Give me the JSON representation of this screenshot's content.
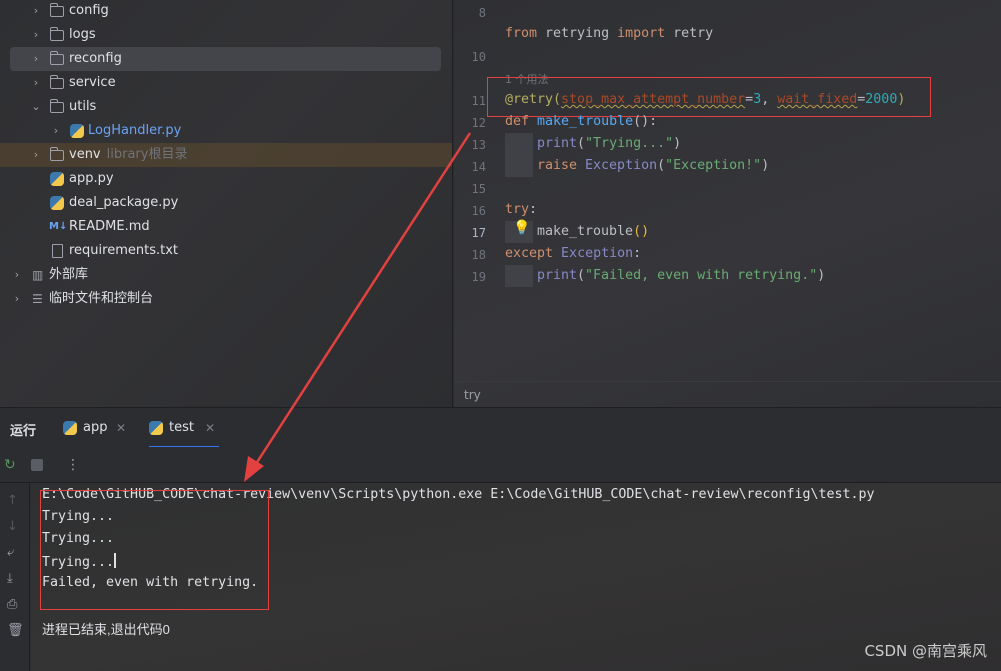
{
  "project_tree": {
    "items": [
      {
        "label": "config",
        "hint": ""
      },
      {
        "label": "logs",
        "hint": ""
      },
      {
        "label": "reconfig",
        "hint": ""
      },
      {
        "label": "service",
        "hint": ""
      },
      {
        "label": "utils",
        "hint": ""
      },
      {
        "label": "LogHandler.py",
        "hint": ""
      },
      {
        "label": "venv",
        "hint": "library根目录"
      },
      {
        "label": "app.py",
        "hint": ""
      },
      {
        "label": "deal_package.py",
        "hint": ""
      },
      {
        "label": "README.md",
        "hint": ""
      },
      {
        "label": "requirements.txt",
        "hint": ""
      },
      {
        "label": "外部库",
        "hint": ""
      },
      {
        "label": "临时文件和控制台",
        "hint": ""
      }
    ]
  },
  "editor": {
    "line_numbers": [
      "8",
      "10",
      "11",
      "12",
      "13",
      "14",
      "15",
      "16",
      "17",
      "18",
      "19"
    ],
    "usage_hint": "1 个用法",
    "code": {
      "l9_from": "from",
      "l9_module": " retrying ",
      "l9_import": "import",
      "l9_name": " retry",
      "l11_dec": "@retry(",
      "l11_p1": "stop_max_attempt_number",
      "l11_eq1": "=",
      "l11_v1": "3",
      "l11_comma": ", ",
      "l11_p2": "wait_fixed",
      "l11_eq2": "=",
      "l11_v2": "2000",
      "l11_close": ")",
      "l12_def": "def",
      "l12_fn": " make_trouble",
      "l12_rest": "():",
      "l13_print": "print",
      "l13_open": "(",
      "l13_str": "\"Trying...\"",
      "l13_close": ")",
      "l14_raise": "raise",
      "l14_exc": " Exception",
      "l14_open": "(",
      "l14_str": "\"Exception!\"",
      "l14_close": ")",
      "l16_try": "try",
      "l16_colon": ":",
      "l17_call": "make_trouble",
      "l17_paren": "()",
      "l18_except": "except",
      "l18_exc": " Exception",
      "l18_colon": ":",
      "l19_print": "print",
      "l19_open": "(",
      "l19_str": "\"Failed, even with retrying.\"",
      "l19_close": ")"
    },
    "breadcrumb": "try"
  },
  "run_panel": {
    "title": "运行",
    "tabs": [
      {
        "label": "app",
        "active": false
      },
      {
        "label": "test",
        "active": true
      }
    ],
    "console": {
      "command": "E:\\Code\\GitHUB_CODE\\chat-review\\venv\\Scripts\\python.exe E:\\Code\\GitHUB_CODE\\chat-review\\reconfig\\test.py",
      "lines": [
        "Trying...",
        "Trying...",
        "Trying...",
        "Failed, even with retrying."
      ],
      "exit_message": "进程已结束,退出代码0"
    }
  },
  "watermark": "CSDN @南宫乘风",
  "colors": {
    "annotation_red": "#e34040",
    "accent_blue": "#3574f0"
  }
}
